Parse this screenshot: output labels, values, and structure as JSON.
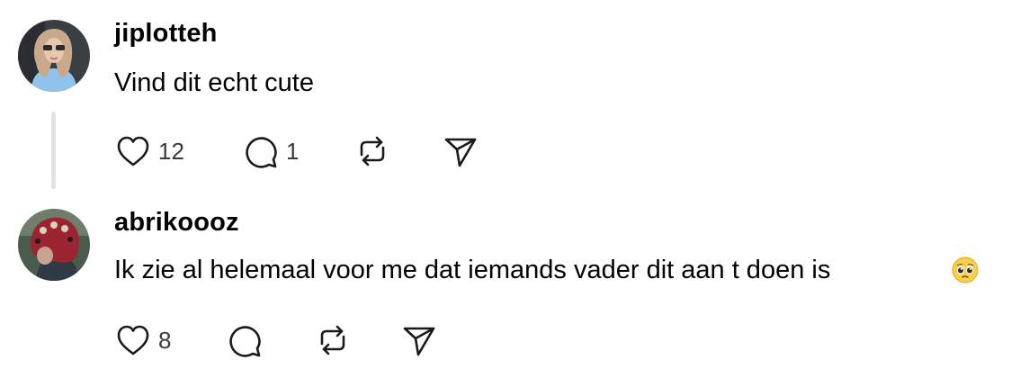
{
  "comments": [
    {
      "username": "jiplotteh",
      "text": "Vind dit echt cute",
      "likes": "12",
      "replies": "1",
      "icons": [
        "heart-icon",
        "comment-icon",
        "repost-icon",
        "share-icon"
      ]
    },
    {
      "username": "abrikoooz",
      "text": "Ik zie al helemaal voor me dat iemands vader dit aan t doen is",
      "emoji": "pleading-face-emoji",
      "likes": "8",
      "replies": "",
      "icons": [
        "heart-icon",
        "comment-icon",
        "repost-icon",
        "share-icon"
      ]
    }
  ],
  "colors": {
    "text": "#000000",
    "count": "#3a3a3a",
    "icon": "#1a1a1a",
    "thread_line": "#e3e3e3",
    "background": "#ffffff"
  }
}
